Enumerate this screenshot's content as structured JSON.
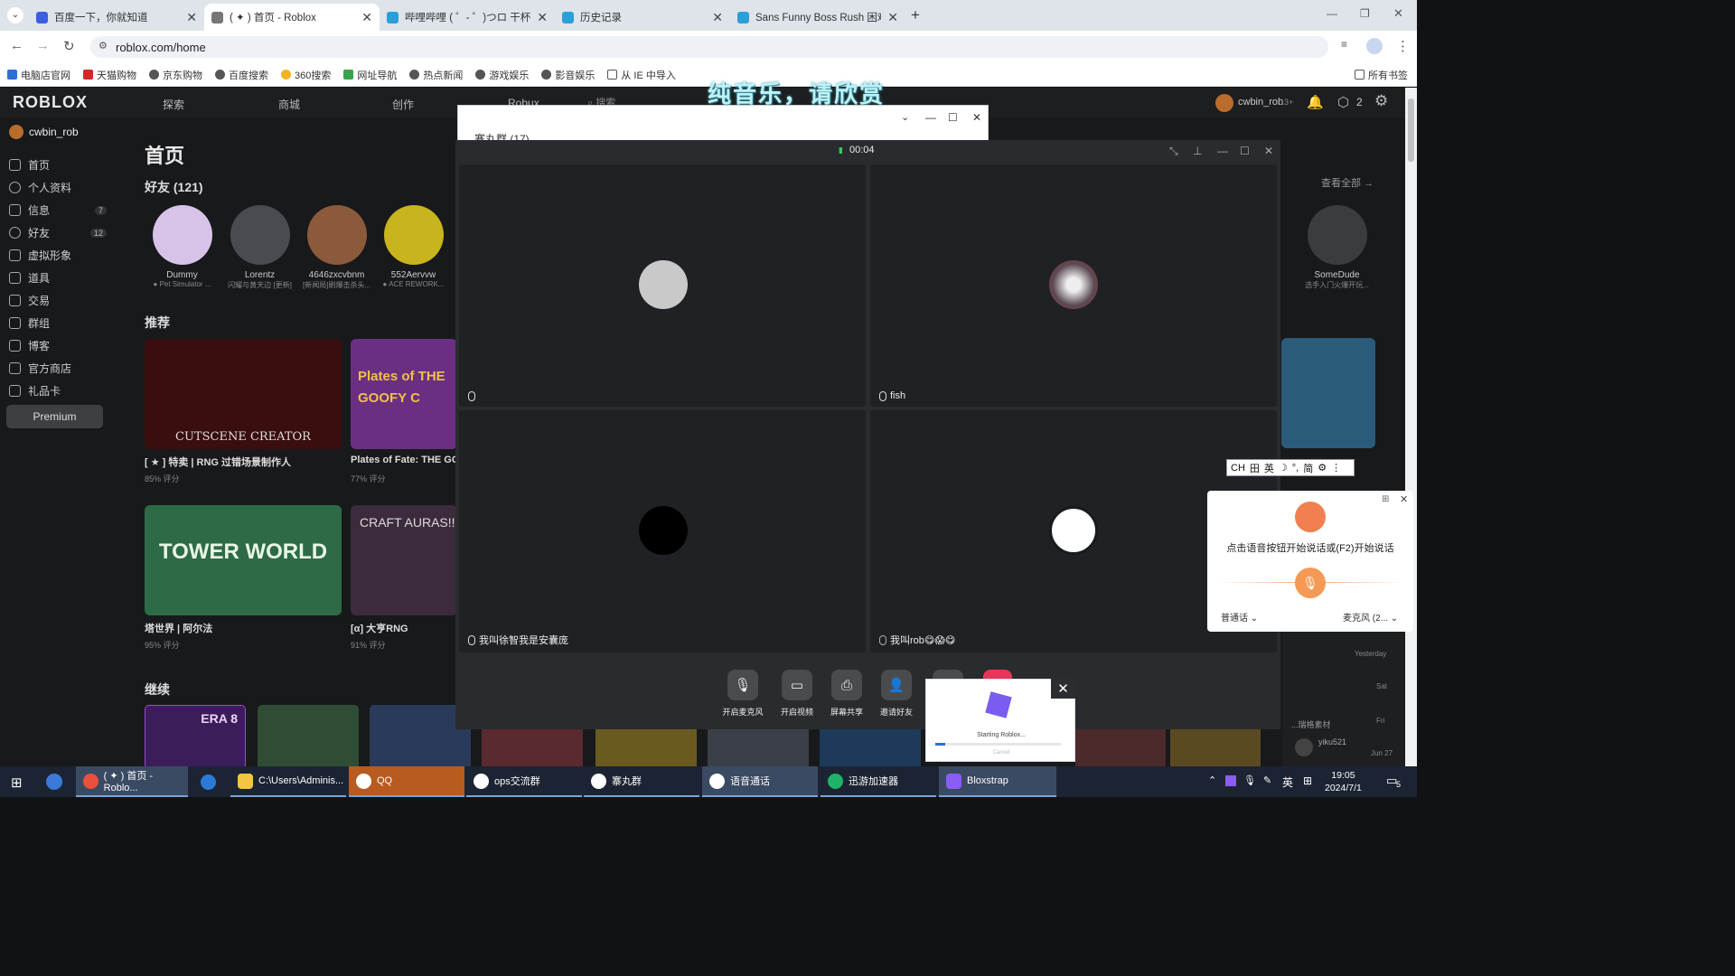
{
  "browser": {
    "tabs": [
      {
        "title": "百度一下，你就知道",
        "color": "#3b5fe0",
        "active": false
      },
      {
        "title": "( ✦ ) 首页 - Roblox",
        "color": "#444444",
        "active": true
      },
      {
        "title": "哔哩哔哩 ( ゜- ゜)つロ 干杯~-bili",
        "color": "#2b9fd8",
        "active": false
      },
      {
        "title": "历史记录",
        "color": "#2b9fd8",
        "active": false
      },
      {
        "title": "Sans Funny Boss Rush 困难模式",
        "color": "#2b9fd8",
        "active": false
      }
    ],
    "new_tab": "+",
    "url": "roblox.com/home",
    "bookmarks": [
      "电脑店官网",
      "天猫购物",
      "京东购物",
      "百度搜索",
      "360搜索",
      "网址导航",
      "热点新闻",
      "游戏娱乐",
      "影音娱乐",
      "从 IE 中导入"
    ],
    "all_bookmarks": "所有书签"
  },
  "overlay_text": "纯音乐，请欣赏",
  "roblox": {
    "logo": "ROBLOX",
    "nav": [
      "探索",
      "商城",
      "创作",
      "Robux"
    ],
    "search_placeholder": "搜索",
    "user": "cwbin_rob",
    "user_age": "13+",
    "robux_count": "2",
    "sidebar": [
      {
        "label": "首页",
        "count": ""
      },
      {
        "label": "个人资料",
        "count": ""
      },
      {
        "label": "信息",
        "count": "7"
      },
      {
        "label": "好友",
        "count": "12"
      },
      {
        "label": "虚拟形象",
        "count": ""
      },
      {
        "label": "道具",
        "count": ""
      },
      {
        "label": "交易",
        "count": ""
      },
      {
        "label": "群组",
        "count": ""
      },
      {
        "label": "博客",
        "count": ""
      },
      {
        "label": "官方商店",
        "count": ""
      },
      {
        "label": "礼品卡",
        "count": ""
      }
    ],
    "premium": "Premium",
    "page_title": "首页",
    "friends_heading": "好友 (121)",
    "see_all": "查看全部 →",
    "friends": [
      {
        "name": "Dummy",
        "status": "● Pet Simulator ..."
      },
      {
        "name": "Lorentz",
        "status": "闪耀与黄天边 [更新]"
      },
      {
        "name": "4646zxcvbnm",
        "status": "[新闻局]刷爆击杀头..."
      },
      {
        "name": "552Aervvw",
        "status": "● ACE REWORK..."
      },
      {
        "name": "SomeDude",
        "status": "选手入门火爆开玩..."
      }
    ],
    "recommended_heading": "推荐",
    "recommended": [
      {
        "title": "[ ★ ] 特卖 | RNG 过错场景制作人",
        "rating": "85% 评分",
        "art": "CUTSCENE CREATOR"
      },
      {
        "title": "Plates of Fate: THE GOOFY CH",
        "rating": "77% 评分",
        "art": "Plates of THE GOOFY C"
      },
      {
        "title": "塔世界 | 阿尔法",
        "rating": "95% 评分",
        "art": "TOWER WORLD"
      },
      {
        "title": "[α] 大亨RNG",
        "rating": "91% 评分",
        "art": "CRAFT AURAS!!"
      }
    ],
    "continue_heading": "继续",
    "continue_art": "ERA 8",
    "right_column": [
      "Yesterday",
      "Sat",
      "Fri",
      "Jun 27"
    ],
    "right_user": "yiku521",
    "right_snippet": "...瑞格素材"
  },
  "qq_group": {
    "title": "寨丸群 (17)"
  },
  "call": {
    "timer": "00:04",
    "participants": [
      {
        "name": "",
        "muted": false,
        "avatar": "#c9c9c9"
      },
      {
        "name": "fish",
        "muted": false,
        "avatar": "#7a6b78"
      },
      {
        "name": "我叫徐智我是安囊庞",
        "muted": false,
        "avatar": "#000000"
      },
      {
        "name": "我叫rob😋😱😋",
        "muted": true,
        "avatar": "#ffffff"
      }
    ],
    "controls": [
      "开启麦克风",
      "开启视频",
      "屏幕共享",
      "邀请好友"
    ]
  },
  "bloxstrap": {
    "status": "Starting Roblox...",
    "cancel": "Cancel",
    "progress": 0.08
  },
  "ime": {
    "items": [
      "CH",
      "田",
      "英",
      "☽",
      "°,",
      "简",
      "⚙",
      "⋮"
    ]
  },
  "voice_panel": {
    "prompt": "点击语音按钮开始说话或(F2)开始说话",
    "language": "普通话",
    "mic": "麦克风 (2..."
  },
  "taskbar": {
    "items": [
      {
        "label": "( ✦ ) 首页 - Roblo...",
        "color": "#e9513c"
      },
      {
        "label": "",
        "color": "#2b7bd6"
      },
      {
        "label": "C:\\Users\\Adminis...",
        "color": "#f4c542"
      },
      {
        "label": "QQ",
        "color": "#ffffff"
      },
      {
        "label": "ops交流群",
        "color": "#ffffff"
      },
      {
        "label": "寨丸群",
        "color": "#ffffff"
      },
      {
        "label": "语音通话",
        "color": "#ffffff"
      },
      {
        "label": "迅游加速器",
        "color": "#1fb36a"
      },
      {
        "label": "Bloxstrap",
        "color": "#8b5cf6"
      }
    ],
    "tray_lang": "英",
    "time": "19:05",
    "date": "2024/7/1",
    "notifications": "5"
  }
}
